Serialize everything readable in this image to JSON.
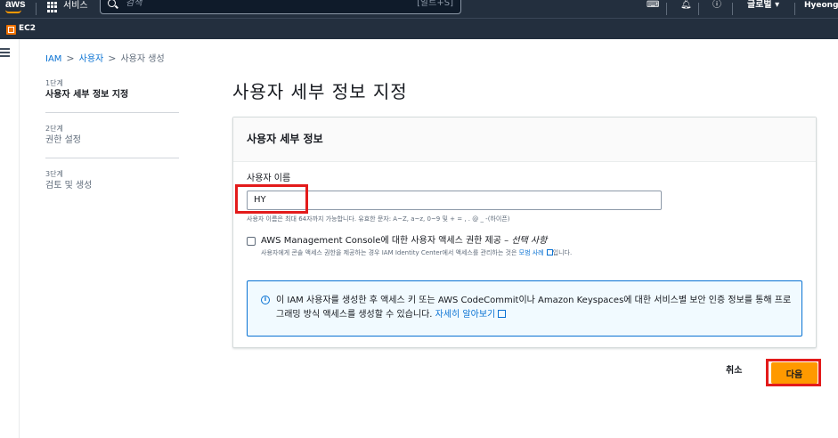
{
  "topnav": {
    "logo": "aws",
    "services_label": "서비스",
    "search_placeholder": "검색",
    "search_shortcut": "[알트+S]",
    "region": "글로벌 ▾",
    "user": "HyeongY"
  },
  "favorites": {
    "ec2_label": "EC2"
  },
  "breadcrumb": {
    "items": [
      "IAM",
      "사용자",
      "사용자 생성"
    ]
  },
  "steps": [
    {
      "num": "1단계",
      "name": "사용자 세부 정보 지정"
    },
    {
      "num": "2단계",
      "name": "권한 설정"
    },
    {
      "num": "3단계",
      "name": "검토 및 생성"
    }
  ],
  "page_title": "사용자 세부 정보 지정",
  "container": {
    "header": "사용자 세부 정보",
    "username_label": "사용자 이름",
    "username_value": "HY",
    "constraint": "사용자 이름은 최대 64자까지 가능합니다. 유효한 문자: A~Z, a~z, 0~9 및 + = , . @ _ -(하이픈)",
    "console_access_label": "AWS Management Console에 대한 사용자 액세스 권한 제공 – ",
    "console_access_optional": "선택 사항",
    "console_access_desc_pre": "사용자에게 콘솔 액세스 권한을 제공하는 경우 IAM Identity Center에서 액세스를 관리하는 것은 ",
    "console_access_desc_link": "모범 사례",
    "console_access_desc_post": "입니다.",
    "info_text": "이 IAM 사용자를 생성한 후 액세스 키 또는 AWS CodeCommit이나 Amazon Keyspaces에 대한 서비스별 보안 인증 정보를 통해 프로그래밍 방식 액세스를 생성할 수 있습니다. ",
    "info_link": "자세히 알아보기"
  },
  "footer": {
    "cancel": "취소",
    "next": "다음"
  },
  "colors": {
    "nav_bg": "#232f3e",
    "primary_button": "#ff9900",
    "link": "#0972d3",
    "annotation": "#e31b1b"
  }
}
